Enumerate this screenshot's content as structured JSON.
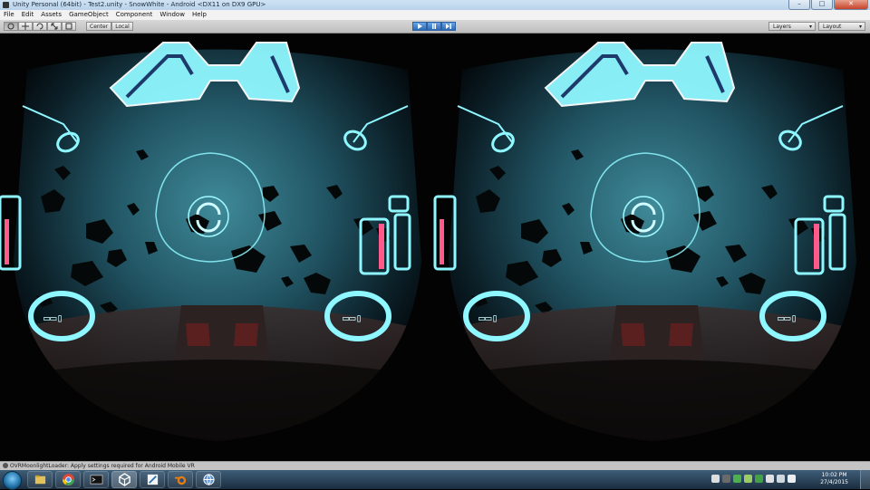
{
  "window": {
    "title": "Unity Personal (64bit) - Test2.unity - SnowWhite - Android <DX11 on DX9 GPU>",
    "icon": "unity-icon",
    "buttons": [
      "–",
      "□",
      "✕"
    ]
  },
  "menu": {
    "items": [
      "File",
      "Edit",
      "Assets",
      "GameObject",
      "Component",
      "Window",
      "Help"
    ]
  },
  "toolbar": {
    "tools": [
      "hand-tool-icon",
      "move-tool-icon",
      "rotate-tool-icon",
      "scale-tool-icon",
      "rect-tool-icon"
    ],
    "pivot_label": "Center",
    "space_label": "Local",
    "playback": [
      "play-icon",
      "pause-icon",
      "step-icon"
    ],
    "layers_label": "Layers",
    "layout_label": "Layout"
  },
  "status": {
    "message": "OVRMoonlightLoader: Apply settings required for Android Mobile VR"
  },
  "taskbar": {
    "apps": [
      "windows-explorer-icon",
      "chrome-icon",
      "terminal-icon",
      "unity-icon",
      "sketch-icon",
      "blender-icon",
      "globe-icon"
    ],
    "active_app": "unity-icon",
    "time": "10:02 PM",
    "date": "27/4/2015"
  },
  "colors": {
    "hud_cyan": "#7ff2ff",
    "hud_glow": "#2bd0ff",
    "nebula": "#2f6b7a",
    "taskbar": "#1f3448"
  }
}
